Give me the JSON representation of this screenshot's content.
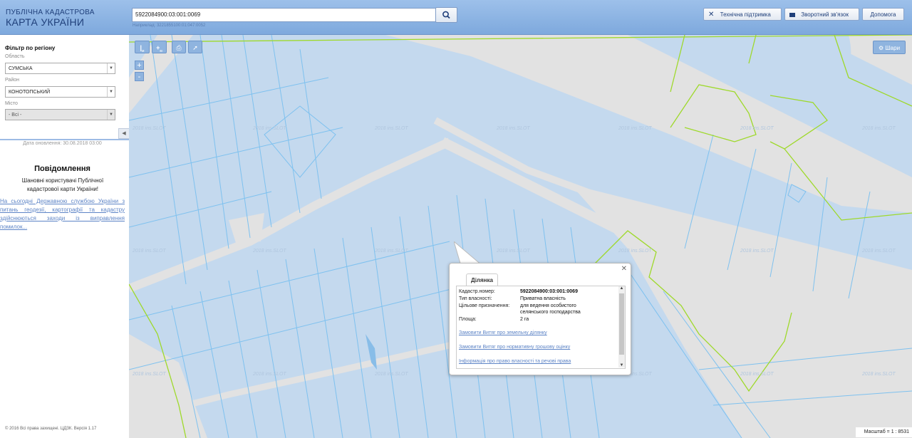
{
  "header": {
    "logo_line1": "ПУБЛІЧНА КАДАСТРОВА",
    "logo_line2": "КАРТА УКРАЇНИ",
    "search_value": "5922084900:03:001:0069",
    "search_hint": "Наприклад: 3221855100:01:047:0052",
    "support_label": "Технічна підтримка",
    "feedback_label": "Зворотний зв'язок",
    "help_label": "Допомога"
  },
  "sidebar": {
    "filter_title": "Фільтр по регіону",
    "region_label": "Область",
    "region_value": "СУМСЬКА",
    "district_label": "Район",
    "district_value": "КОНОТОПСЬКИЙ",
    "city_label": "Місто",
    "city_value": "- Всі -",
    "update_date": "Дата оновлення: 30.08.2018 03:00",
    "notice_title": "Повідомлення",
    "notice_text": "Шановні користувачі Публічної кадастрової карти України!",
    "notice_link": "На сьогодні Державною службою України з питань геодезії, картографії та кадастру здійснюються заходи із виправлення помилок...",
    "copyright": "© 2016 Всі права захищені. ЦДЗК. Версія 1.17"
  },
  "map": {
    "layers_label": "Шари",
    "scale_text": "Масштаб = 1 : 8531",
    "watermark": "2018 ins.SLOT",
    "tool_ruler": "м",
    "tool_area": "м",
    "zoom_in": "+",
    "zoom_out": "-"
  },
  "popup": {
    "tab_label": "Ділянка",
    "rows": [
      {
        "label": "Кадастр.номер:",
        "value": "5922084900:03:001:0069"
      },
      {
        "label": "Тип власності:",
        "value": "Приватна власність"
      },
      {
        "label": "Цільове призначення:",
        "value": "для ведення особистого селянського господарства"
      },
      {
        "label": "Площа:",
        "value": "2 га"
      }
    ],
    "link1": "Замовити Витяг про земельну ділянку",
    "link2": "Замовити Витяг про нормативну грошову оцінку",
    "link3": "Інформація про право власності та речові права"
  },
  "colors": {
    "parcel_fill": "#c4d9ee",
    "parcel_line": "#7ec1ef",
    "boundary_green": "#9ed92a",
    "road": "#dfdfdf",
    "header_blue": "#8fb3e2"
  }
}
